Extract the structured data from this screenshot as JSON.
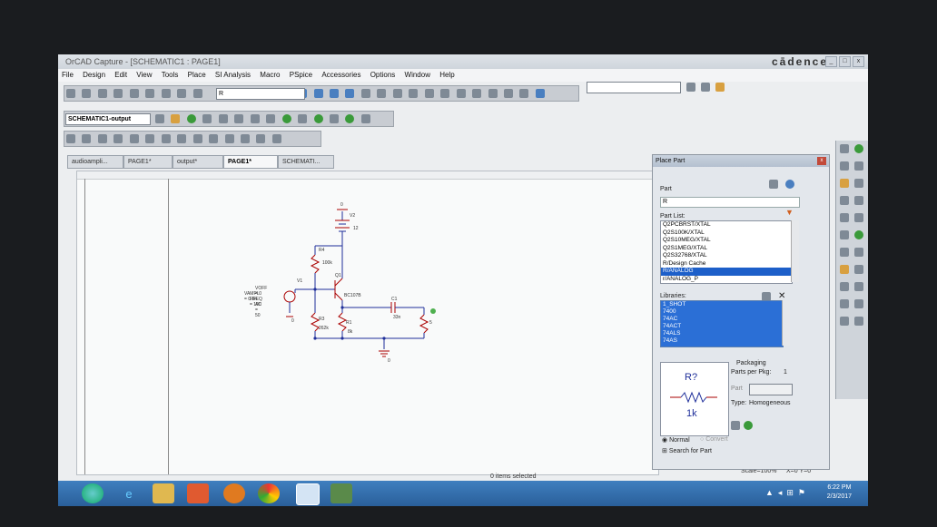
{
  "app": {
    "title": "OrCAD Capture - [SCHEMATIC1 : PAGE1]",
    "brand": "cādence",
    "window_buttons": [
      "_",
      "□",
      "x"
    ]
  },
  "menu": [
    "File",
    "Design",
    "Edit",
    "View",
    "Tools",
    "Place",
    "SI Analysis",
    "Macro",
    "PSpice",
    "Accessories",
    "Options",
    "Window",
    "Help"
  ],
  "toolbar": {
    "part_combo_value": "R",
    "profile_combo_value": "SCHEMATIC1-output"
  },
  "tabs": [
    {
      "label": "audioampli..."
    },
    {
      "label": "PAGE1*"
    },
    {
      "label": "output*"
    },
    {
      "label": "PAGE1*"
    },
    {
      "label": "SCHEMATI..."
    }
  ],
  "schematic": {
    "labels": {
      "v2": "V2",
      "v2_val": "12",
      "r4": "R4",
      "r4_val": "100k",
      "q1": "Q1",
      "q1_part": "BC107B",
      "v1": "V1",
      "v1_params": [
        "VOFF = 0",
        "VAMPL = 0.04",
        "FREQ = 100",
        "AC = 50"
      ],
      "c1": "C1",
      "c1_val": "33n",
      "r3": "R3",
      "r3_val": "262k",
      "r1": "R1",
      "r1_val": "8k",
      "rload_val": "5",
      "gnd1": "0",
      "gnd2": "0",
      "gnd3": "0"
    }
  },
  "status": {
    "selection": "0 items selected",
    "scale": "Scale=100%",
    "coords": "X=0  Y=0"
  },
  "place_part": {
    "title": "Place Part",
    "part_label": "Part",
    "part_value": "R",
    "part_list_label": "Part List:",
    "part_list": [
      "Q2PCBRST/XTAL",
      "Q2S100K/XTAL",
      "Q2S10MEG/XTAL",
      "Q2S1MEG/XTAL",
      "Q2S32768/XTAL",
      "R/Design Cache",
      "R/ANALOG",
      "r/ANALOG_P"
    ],
    "selected_index": 6,
    "libraries_label": "Libraries:",
    "libraries": [
      "1_SHOT",
      "7400",
      "74AC",
      "74ACT",
      "74ALS",
      "74AS"
    ],
    "packaging_label": "Packaging",
    "parts_per_pkg_label": "Parts per Pkg:",
    "parts_per_pkg": "1",
    "part_field_label": "Part",
    "type_label": "Type:",
    "type_value": "Homogeneous",
    "preview_ref": "R?",
    "preview_value": "1k",
    "normal": "Normal",
    "convert": "Convert",
    "search": "Search for Part"
  },
  "taskbar": {
    "time": "6:22 PM",
    "date": "2/3/2017"
  }
}
